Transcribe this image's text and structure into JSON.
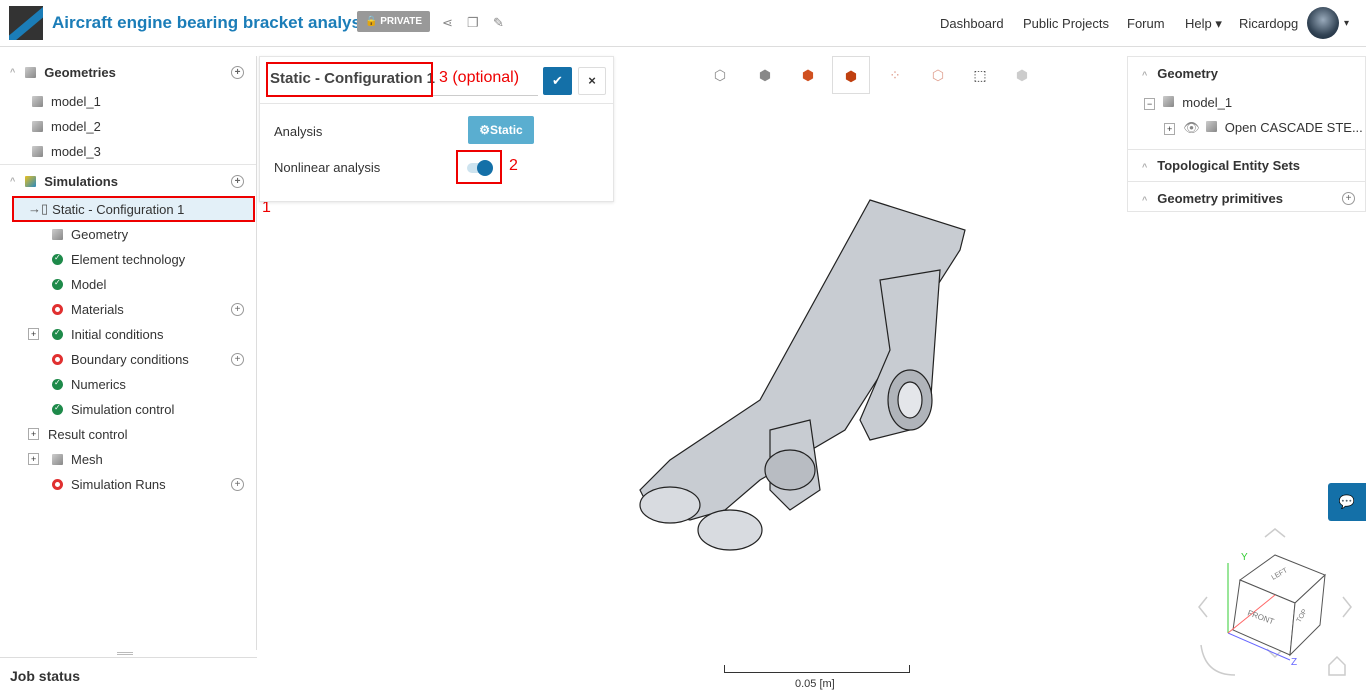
{
  "header": {
    "title": "Aircraft engine bearing bracket analysis",
    "private": "PRIVATE",
    "nav": [
      "Dashboard",
      "Public Projects",
      "Forum",
      "Help",
      "Ricardopg"
    ]
  },
  "tree": {
    "geometries": "Geometries",
    "models": [
      "model_1",
      "model_2",
      "model_3"
    ],
    "simulations": "Simulations",
    "sim": "Static - Configuration 1",
    "items": [
      {
        "label": "Geometry",
        "status": "ok"
      },
      {
        "label": "Element technology",
        "status": "ok"
      },
      {
        "label": "Model",
        "status": "ok"
      },
      {
        "label": "Materials",
        "status": "bad"
      },
      {
        "label": "Initial conditions",
        "status": "ok"
      },
      {
        "label": "Boundary conditions",
        "status": "bad"
      },
      {
        "label": "Numerics",
        "status": "ok"
      },
      {
        "label": "Simulation control",
        "status": "ok"
      },
      {
        "label": "Result control",
        "status": "none"
      },
      {
        "label": "Mesh",
        "status": "none"
      },
      {
        "label": "Simulation Runs",
        "status": "bad"
      }
    ]
  },
  "job_status": "Job status",
  "panel": {
    "name": "Static - Configuration 1",
    "analysis_label": "Analysis",
    "analysis_value": "Static",
    "nonlinear_label": "Nonlinear analysis",
    "nonlinear_on": true
  },
  "annotations": {
    "a1": "1",
    "a2": "2",
    "a3": "3 (optional)"
  },
  "right": {
    "geometry": "Geometry",
    "model": "model_1",
    "entity": "Open CASCADE STE...",
    "topo": "Topological Entity Sets",
    "prims": "Geometry primitives"
  },
  "scale": "0.05 [m]",
  "cube": {
    "front": "FRONT",
    "left": "LEFT",
    "top": "TOP",
    "y": "Y",
    "z": "Z"
  }
}
